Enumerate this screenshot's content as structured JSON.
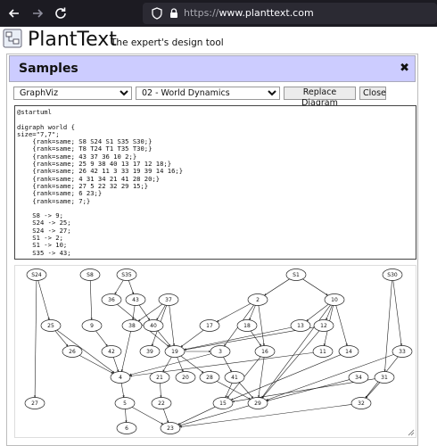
{
  "browser": {
    "url_scheme": "https://",
    "url_host": "www.planttext.com",
    "back_icon": "arrow-left-icon",
    "forward_icon": "arrow-right-icon",
    "reload_icon": "reload-icon",
    "shield_icon": "shield-icon",
    "lock_icon": "lock-icon"
  },
  "header": {
    "brand": "PlantText",
    "tagline": "The expert's design tool"
  },
  "dialog": {
    "title": "Samples",
    "close_glyph": "✖",
    "type_select": "GraphViz",
    "sample_select": "02 - World Dynamics",
    "replace_button": "Replace Diagram",
    "close_button": "Close",
    "source_lines": [
      "@startuml",
      "",
      "digraph world {",
      "size=\"7,7\";",
      "    {rank=same; S8 S24 S1 S35 S30;}",
      "    {rank=same; T8 T24 T1 T35 T30;}",
      "    {rank=same; 43 37 36 10 2;}",
      "    {rank=same; 25 9 38 40 13 17 12 18;}",
      "    {rank=same; 26 42 11 3 33 19 39 14 16;}",
      "    {rank=same; 4 31 34 21 41 28 20;}",
      "    {rank=same; 27 5 22 32 29 15;}",
      "    {rank=same; 6 23;}",
      "    {rank=same; 7;}",
      "",
      "    S8 -> 9;",
      "    S24 -> 25;",
      "    S24 -> 27;",
      "    S1 -> 2;",
      "    S1 -> 10;",
      "    S35 -> 43;"
    ]
  },
  "diagram": {
    "nodes": [
      {
        "id": "S24",
        "label": "S24"
      },
      {
        "id": "S8",
        "label": "S8"
      },
      {
        "id": "S35",
        "label": "S35"
      },
      {
        "id": "S1",
        "label": "S1"
      },
      {
        "id": "S30",
        "label": "S30"
      },
      {
        "id": "36",
        "label": "36"
      },
      {
        "id": "43",
        "label": "43"
      },
      {
        "id": "37",
        "label": "37"
      },
      {
        "id": "2",
        "label": "2"
      },
      {
        "id": "10",
        "label": "10"
      },
      {
        "id": "25",
        "label": "25"
      },
      {
        "id": "9",
        "label": "9"
      },
      {
        "id": "38",
        "label": "38"
      },
      {
        "id": "40",
        "label": "40"
      },
      {
        "id": "17",
        "label": "17"
      },
      {
        "id": "18",
        "label": "18"
      },
      {
        "id": "13",
        "label": "13"
      },
      {
        "id": "12",
        "label": "12"
      },
      {
        "id": "26",
        "label": "26"
      },
      {
        "id": "42",
        "label": "42"
      },
      {
        "id": "39",
        "label": "39"
      },
      {
        "id": "19",
        "label": "19"
      },
      {
        "id": "3",
        "label": "3"
      },
      {
        "id": "16",
        "label": "16"
      },
      {
        "id": "11",
        "label": "11"
      },
      {
        "id": "14",
        "label": "14"
      },
      {
        "id": "33",
        "label": "33"
      },
      {
        "id": "4",
        "label": "4"
      },
      {
        "id": "21",
        "label": "21"
      },
      {
        "id": "20",
        "label": "20"
      },
      {
        "id": "28",
        "label": "28"
      },
      {
        "id": "41",
        "label": "41"
      },
      {
        "id": "34",
        "label": "34"
      },
      {
        "id": "31",
        "label": "31"
      },
      {
        "id": "27",
        "label": "27"
      },
      {
        "id": "5",
        "label": "5"
      },
      {
        "id": "22",
        "label": "22"
      },
      {
        "id": "15",
        "label": "15"
      },
      {
        "id": "29",
        "label": "29"
      },
      {
        "id": "32",
        "label": "32"
      },
      {
        "id": "6",
        "label": "6"
      },
      {
        "id": "23",
        "label": "23"
      }
    ],
    "edges": [
      [
        "S24",
        "25"
      ],
      [
        "S24",
        "27"
      ],
      [
        "S8",
        "9"
      ],
      [
        "S35",
        "43"
      ],
      [
        "S35",
        "36"
      ],
      [
        "S1",
        "2"
      ],
      [
        "S1",
        "10"
      ],
      [
        "S30",
        "33"
      ],
      [
        "S30",
        "31"
      ],
      [
        "36",
        "19"
      ],
      [
        "43",
        "38"
      ],
      [
        "43",
        "40"
      ],
      [
        "37",
        "38"
      ],
      [
        "37",
        "40"
      ],
      [
        "37",
        "39"
      ],
      [
        "37",
        "19"
      ],
      [
        "2",
        "17"
      ],
      [
        "2",
        "18"
      ],
      [
        "2",
        "16"
      ],
      [
        "2",
        "3"
      ],
      [
        "10",
        "13"
      ],
      [
        "10",
        "12"
      ],
      [
        "10",
        "11"
      ],
      [
        "10",
        "14"
      ],
      [
        "10",
        "29"
      ],
      [
        "25",
        "26"
      ],
      [
        "25",
        "4"
      ],
      [
        "9",
        "42"
      ],
      [
        "38",
        "4"
      ],
      [
        "40",
        "19"
      ],
      [
        "17",
        "19"
      ],
      [
        "18",
        "16"
      ],
      [
        "13",
        "19"
      ],
      [
        "12",
        "19"
      ],
      [
        "12",
        "29"
      ],
      [
        "26",
        "4"
      ],
      [
        "42",
        "4"
      ],
      [
        "19",
        "21"
      ],
      [
        "19",
        "20"
      ],
      [
        "19",
        "28"
      ],
      [
        "19",
        "3"
      ],
      [
        "3",
        "4"
      ],
      [
        "3",
        "41"
      ],
      [
        "16",
        "15"
      ],
      [
        "16",
        "29"
      ],
      [
        "11",
        "4"
      ],
      [
        "14",
        "15"
      ],
      [
        "33",
        "29"
      ],
      [
        "33",
        "32"
      ],
      [
        "4",
        "5"
      ],
      [
        "21",
        "22"
      ],
      [
        "41",
        "15"
      ],
      [
        "41",
        "29"
      ],
      [
        "34",
        "29"
      ],
      [
        "31",
        "32"
      ],
      [
        "31",
        "15"
      ],
      [
        "28",
        "29"
      ],
      [
        "5",
        "6"
      ],
      [
        "5",
        "23"
      ],
      [
        "22",
        "23"
      ],
      [
        "32",
        "23"
      ],
      [
        "15",
        "23"
      ],
      [
        "29",
        "23"
      ]
    ]
  }
}
